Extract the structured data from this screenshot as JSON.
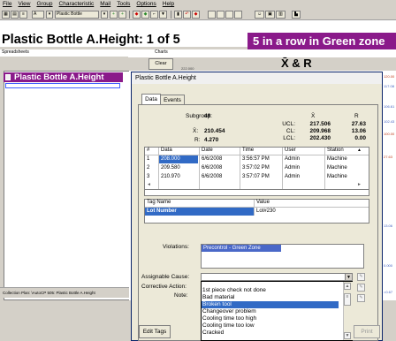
{
  "menu": [
    "File",
    "View",
    "Group",
    "Characteristic",
    "Mail",
    "Tools",
    "Options",
    "Help"
  ],
  "toolbar": {
    "field_a": "A",
    "field_name": "Plastic Bottle A.Height"
  },
  "main_title": "Plastic Bottle A.Height:  1 of 5",
  "alarm_banner": "5 in a row in Green zone",
  "labels": {
    "spreadsheets": "Spreadsheets",
    "charts": "Charts"
  },
  "chart": {
    "clear_label": "Clear",
    "clear_value": "222.000",
    "title": "X̄ & R",
    "axis": [
      "120.00",
      "117.08",
      "106.61",
      "102.43",
      "100.00",
      "27.63",
      "13.06",
      "0.000",
      "=0.67"
    ]
  },
  "spreadsheet": {
    "header": "Plastic Bottle A.Height"
  },
  "status_bar": "Collection Plan: \\AutoCP 505: Plastic Bottle A.Height",
  "dialog": {
    "title": "Plastic Bottle A.Height",
    "tabs": [
      "Data",
      "Events"
    ],
    "subgroup_label": "Subgroup:",
    "subgroup_value": "48",
    "xbar_label": "X̄:",
    "xbar_value": "210.454",
    "r_label": "R:",
    "r_value": "4.270",
    "stats_header_x": "X̄",
    "stats_header_r": "R",
    "ucl_label": "UCL:",
    "ucl_x": "217.506",
    "ucl_r": "27.63",
    "cl_label": "CL:",
    "cl_x": "209.968",
    "cl_r": "13.06",
    "lcl_label": "LCL:",
    "lcl_x": "202.430",
    "lcl_r": "0.00",
    "data_columns": [
      "#",
      "Data",
      "Date",
      "Time",
      "User",
      "Station"
    ],
    "data_rows": [
      [
        "1",
        "208.000",
        "6/6/2008",
        "3:56:57 PM",
        "Admin",
        "Machine"
      ],
      [
        "2",
        "209.580",
        "6/6/2008",
        "3:57:02 PM",
        "Admin",
        "Machine"
      ],
      [
        "3",
        "210.970",
        "6/6/2008",
        "3:57:07 PM",
        "Admin",
        "Machine"
      ]
    ],
    "tag_columns": [
      "Tag Name",
      "Value"
    ],
    "tag_row": [
      "Lot Number",
      "Lot#230"
    ],
    "violations_label": "Violations:",
    "violation_item": "Precontrol - Green Zone",
    "assignable_label": "Assignable Cause:",
    "corrective_label": "Corrective Action:",
    "note_label": "Note:",
    "dropdown_options": [
      "1st piece check not done",
      "Bad material",
      "Broken tool",
      "Changeover problem",
      "Cooling time too high",
      "Cooling time too low",
      "Cracked"
    ],
    "selected_option": "Broken tool",
    "edit_tags_label": "Edit Tags",
    "print_label": "Print"
  }
}
